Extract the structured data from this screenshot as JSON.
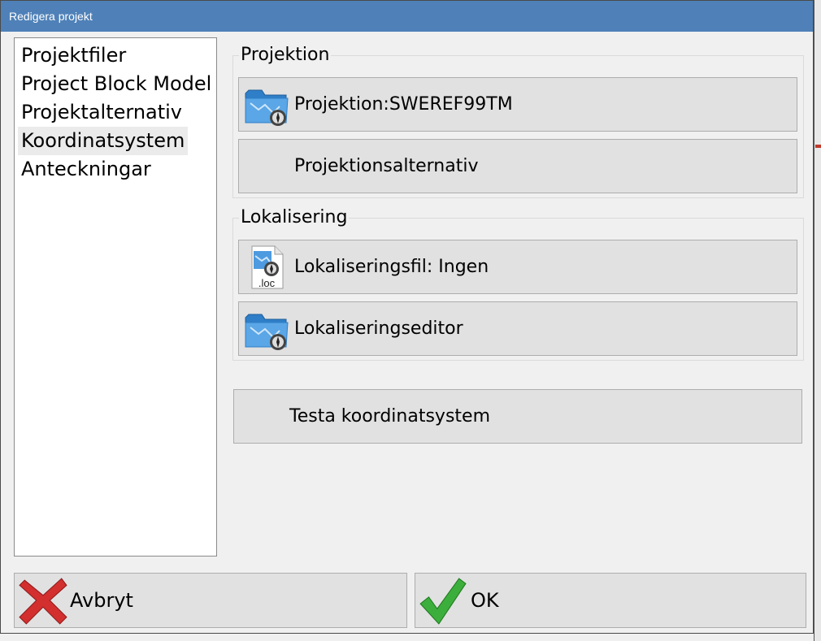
{
  "window": {
    "title": "Redigera projekt"
  },
  "nav": {
    "items": [
      {
        "label": "Projektfiler",
        "selected": false
      },
      {
        "label": "Project Block Model",
        "selected": false
      },
      {
        "label": "Projektalternativ",
        "selected": false
      },
      {
        "label": "Koordinatsystem",
        "selected": true
      },
      {
        "label": "Anteckningar",
        "selected": false
      }
    ]
  },
  "projektion": {
    "group_label": "Projektion",
    "projection_button": "Projektion:SWEREF99TM",
    "options_button": "Projektionsalternativ"
  },
  "lokalisering": {
    "group_label": "Lokalisering",
    "file_button": "Lokaliseringsfil: Ingen",
    "file_icon_text": ".loc",
    "editor_button": "Lokaliseringseditor"
  },
  "test_button": "Testa koordinatsystem",
  "footer": {
    "cancel_label": "Avbryt",
    "ok_label": "OK"
  },
  "colors": {
    "titlebar": "#4f81b8",
    "button_bg": "#e1e1e1",
    "cancel_red": "#d32f2f",
    "ok_green": "#3cae3c"
  }
}
